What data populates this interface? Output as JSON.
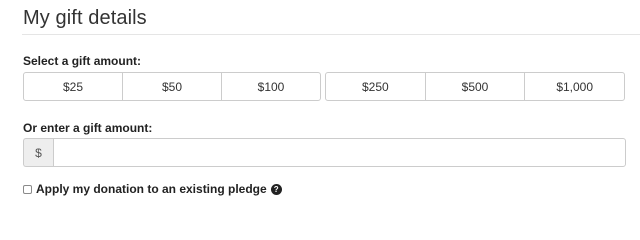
{
  "page_title": "My gift details",
  "amounts_section": {
    "label": "Select a gift amount:",
    "group_one": [
      "$25",
      "$50",
      "$100"
    ],
    "group_two": [
      "$250",
      "$500",
      "$1,000"
    ]
  },
  "custom_amount": {
    "label": "Or enter a gift amount:",
    "currency_symbol": "$",
    "value": "",
    "placeholder": ""
  },
  "pledge_option": {
    "label": "Apply my donation to an existing pledge",
    "checked": false,
    "help_icon": "question-circle-icon",
    "help_glyph": "?"
  }
}
